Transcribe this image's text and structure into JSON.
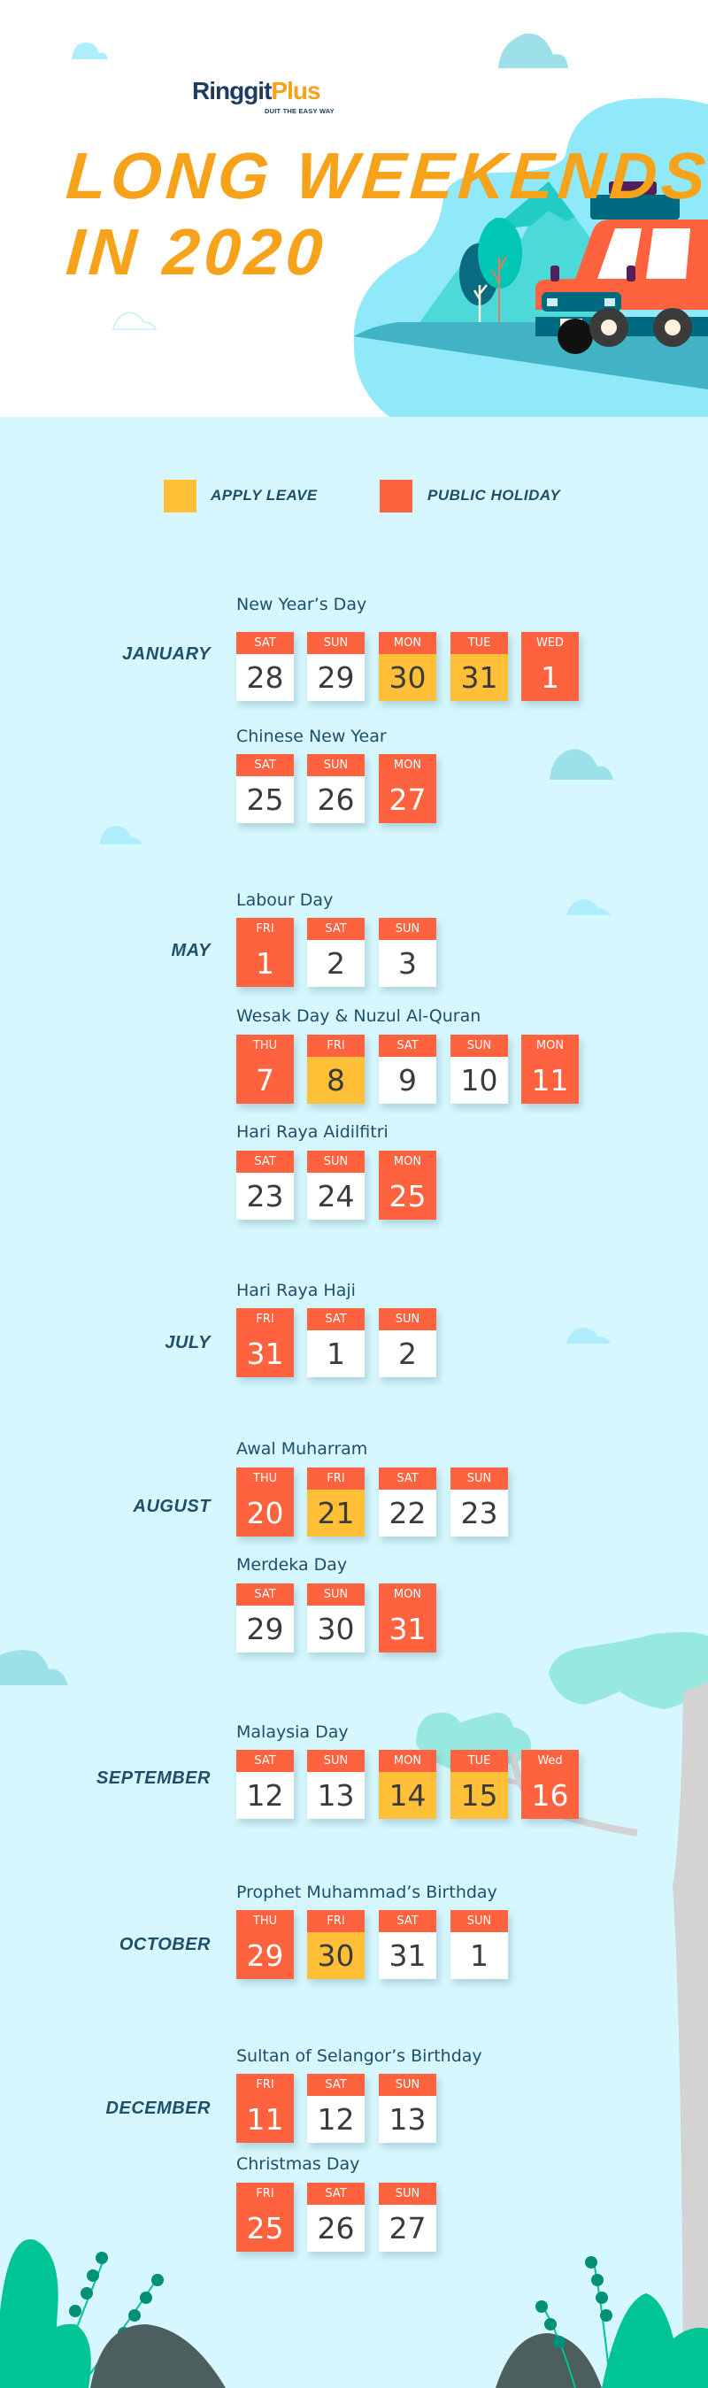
{
  "brand": {
    "name_part1": "Ringgit",
    "name_part2": "Plus",
    "tagline": "DUIT THE EASY WAY"
  },
  "title": {
    "line1": "LONG WEEKENDS",
    "line2": "IN 2020"
  },
  "colors": {
    "apply_leave": "#ffbf36",
    "public_holiday": "#ff623e",
    "weekend": "#ffffff",
    "title": "#f7a21b",
    "text_dark": "#1f4e6b",
    "background": "#d6f7fd"
  },
  "legend": [
    {
      "label": "APPLY LEAVE",
      "type": "leave"
    },
    {
      "label": "PUBLIC HOLIDAY",
      "type": "holiday"
    }
  ],
  "months": [
    {
      "name": "JANUARY",
      "holidays": [
        {
          "name": "New Year’s Day",
          "days": [
            {
              "dow": "SAT",
              "date": "28",
              "type": "weekend"
            },
            {
              "dow": "SUN",
              "date": "29",
              "type": "weekend"
            },
            {
              "dow": "MON",
              "date": "30",
              "type": "leave"
            },
            {
              "dow": "TUE",
              "date": "31",
              "type": "leave"
            },
            {
              "dow": "WED",
              "date": "1",
              "type": "holiday"
            }
          ]
        },
        {
          "name": "Chinese New Year",
          "days": [
            {
              "dow": "SAT",
              "date": "25",
              "type": "weekend"
            },
            {
              "dow": "SUN",
              "date": "26",
              "type": "weekend"
            },
            {
              "dow": "MON",
              "date": "27",
              "type": "holiday"
            }
          ]
        }
      ]
    },
    {
      "name": "MAY",
      "holidays": [
        {
          "name": "Labour Day",
          "days": [
            {
              "dow": "FRI",
              "date": "1",
              "type": "holiday"
            },
            {
              "dow": "SAT",
              "date": "2",
              "type": "weekend"
            },
            {
              "dow": "SUN",
              "date": "3",
              "type": "weekend"
            }
          ]
        },
        {
          "name": "Wesak Day & Nuzul Al-Quran",
          "days": [
            {
              "dow": "THU",
              "date": "7",
              "type": "holiday"
            },
            {
              "dow": "FRI",
              "date": "8",
              "type": "leave"
            },
            {
              "dow": "SAT",
              "date": "9",
              "type": "weekend"
            },
            {
              "dow": "SUN",
              "date": "10",
              "type": "weekend"
            },
            {
              "dow": "MON",
              "date": "11",
              "type": "holiday"
            }
          ]
        },
        {
          "name": "Hari Raya Aidilfitri",
          "days": [
            {
              "dow": "SAT",
              "date": "23",
              "type": "weekend"
            },
            {
              "dow": "SUN",
              "date": "24",
              "type": "weekend"
            },
            {
              "dow": "MON",
              "date": "25",
              "type": "holiday"
            }
          ]
        }
      ]
    },
    {
      "name": "JULY",
      "holidays": [
        {
          "name": "Hari Raya Haji",
          "days": [
            {
              "dow": "FRI",
              "date": "31",
              "type": "holiday"
            },
            {
              "dow": "SAT",
              "date": "1",
              "type": "weekend"
            },
            {
              "dow": "SUN",
              "date": "2",
              "type": "weekend"
            }
          ]
        }
      ]
    },
    {
      "name": "AUGUST",
      "holidays": [
        {
          "name": "Awal Muharram",
          "days": [
            {
              "dow": "THU",
              "date": "20",
              "type": "holiday"
            },
            {
              "dow": "FRI",
              "date": "21",
              "type": "leave"
            },
            {
              "dow": "SAT",
              "date": "22",
              "type": "weekend"
            },
            {
              "dow": "SUN",
              "date": "23",
              "type": "weekend"
            }
          ]
        },
        {
          "name": "Merdeka Day",
          "days": [
            {
              "dow": "SAT",
              "date": "29",
              "type": "weekend"
            },
            {
              "dow": "SUN",
              "date": "30",
              "type": "weekend"
            },
            {
              "dow": "MON",
              "date": "31",
              "type": "holiday"
            }
          ]
        }
      ]
    },
    {
      "name": "SEPTEMBER",
      "holidays": [
        {
          "name": "Malaysia Day",
          "days": [
            {
              "dow": "SAT",
              "date": "12",
              "type": "weekend"
            },
            {
              "dow": "SUN",
              "date": "13",
              "type": "weekend"
            },
            {
              "dow": "MON",
              "date": "14",
              "type": "leave"
            },
            {
              "dow": "TUE",
              "date": "15",
              "type": "leave"
            },
            {
              "dow": "Wed",
              "date": "16",
              "type": "holiday"
            }
          ]
        }
      ]
    },
    {
      "name": "OCTOBER",
      "holidays": [
        {
          "name": "Prophet Muhammad’s Birthday",
          "days": [
            {
              "dow": "THU",
              "date": "29",
              "type": "holiday"
            },
            {
              "dow": "FRI",
              "date": "30",
              "type": "leave"
            },
            {
              "dow": "SAT",
              "date": "31",
              "type": "weekend"
            },
            {
              "dow": "SUN",
              "date": "1",
              "type": "weekend"
            }
          ]
        }
      ]
    },
    {
      "name": "DECEMBER",
      "holidays": [
        {
          "name": "Sultan of Selangor’s Birthday",
          "days": [
            {
              "dow": "FRI",
              "date": "11",
              "type": "holiday"
            },
            {
              "dow": "SAT",
              "date": "12",
              "type": "weekend"
            },
            {
              "dow": "SUN",
              "date": "13",
              "type": "weekend"
            }
          ]
        },
        {
          "name": "Christmas Day",
          "days": [
            {
              "dow": "FRI",
              "date": "25",
              "type": "holiday"
            },
            {
              "dow": "SAT",
              "date": "26",
              "type": "weekend"
            },
            {
              "dow": "SUN",
              "date": "27",
              "type": "weekend"
            }
          ]
        }
      ]
    }
  ]
}
